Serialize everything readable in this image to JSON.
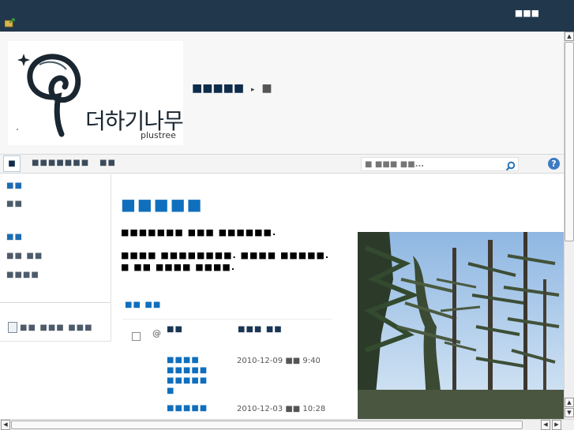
{
  "topbar": {
    "welcome": "■■■"
  },
  "header": {
    "logo_korean": "더하기나무",
    "logo_english": "plustree",
    "site_title": "■■■■■",
    "breadcrumb_arrow": "▸",
    "breadcrumb_current": "■"
  },
  "topnav": {
    "home_label": "■",
    "links": [
      "■■■■■■■",
      "■■"
    ],
    "search_placeholder": "■ ■■■ ■■...",
    "help_label": "?"
  },
  "leftnav": {
    "items": [
      {
        "label": "■■",
        "kind": "hdr"
      },
      {
        "label": "■■",
        "kind": "sub"
      },
      {
        "label": "■■",
        "kind": "hdr"
      },
      {
        "label": "■■ ■■",
        "kind": "sub"
      },
      {
        "label": "■■■■",
        "kind": "sub"
      }
    ],
    "recycle_label": "■■ ■■■ ■■■"
  },
  "content": {
    "page_title": "■■■■■",
    "intro_line1": "■■■■■■■ ■■■ ■■■■■■.",
    "intro_line2": "■■■■ ■■■■■■■■. ■■■■ ■■■■■. ■ ■■ ■■■■ ■■■■.",
    "list_title": "■■ ■■",
    "list_columns": {
      "attach": "@",
      "title": "■■",
      "modified": "■■■ ■■"
    },
    "rows": [
      {
        "title": "■■■■ ■■■■■ ■■■■■ ■",
        "date": "2010-12-09",
        "ampm": "■■",
        "time": "9:40"
      },
      {
        "title": "■■■■■",
        "date": "2010-12-03",
        "ampm": "■■",
        "time": "10:28"
      }
    ]
  }
}
